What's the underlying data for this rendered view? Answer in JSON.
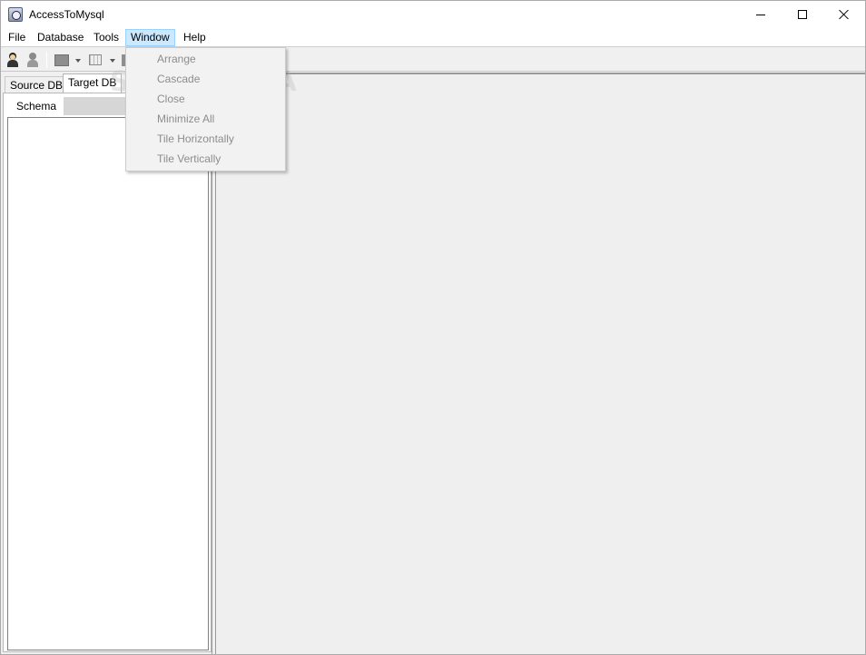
{
  "window": {
    "title": "AccessToMysql"
  },
  "menubar": {
    "items": [
      {
        "label": "File"
      },
      {
        "label": "Database"
      },
      {
        "label": "Tools"
      },
      {
        "label": "Window"
      },
      {
        "label": "Help"
      }
    ]
  },
  "window_menu": {
    "items": [
      {
        "label": "Arrange",
        "enabled": false
      },
      {
        "label": "Cascade",
        "enabled": false
      },
      {
        "label": "Close",
        "enabled": false
      },
      {
        "label": "Minimize All",
        "enabled": false
      },
      {
        "label": "Tile Horizontally",
        "enabled": false
      },
      {
        "label": "Tile Vertically",
        "enabled": false
      }
    ]
  },
  "left_panel": {
    "tabs": [
      {
        "label": "Source DB"
      },
      {
        "label": "Target DB",
        "selected": true
      }
    ],
    "subtabs": [
      {
        "label": "Schema",
        "selected": true
      }
    ]
  },
  "watermark": "SOFTPEDIA",
  "colors": {
    "menu_highlight": "#cce8ff",
    "disabled_text": "#8d8d8d",
    "mdi_background": "#efefef"
  }
}
